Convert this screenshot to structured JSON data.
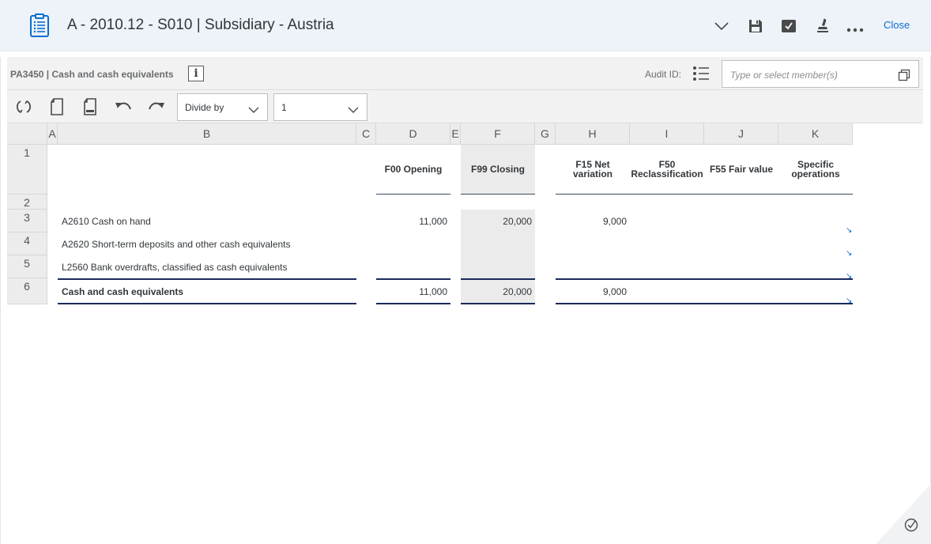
{
  "header": {
    "title": "A - 2010.12 - S010 | Subsidiary - Austria",
    "close_label": "Close",
    "icons": [
      "clipboard-list-icon",
      "chevron-down-icon",
      "save-icon",
      "checkbox-icon",
      "stamp-icon",
      "more-icon"
    ]
  },
  "infobar": {
    "form_title": "PA3450 | Cash and cash equivalents",
    "info_glyph": "i",
    "audit_label": "Audit ID:",
    "member_placeholder": "Type or select member(s)"
  },
  "toolbar": {
    "divide_label": "Divide by",
    "scale_value": "1"
  },
  "grid": {
    "column_letters": [
      "A",
      "B",
      "C",
      "D",
      "E",
      "F",
      "G",
      "H",
      "I",
      "J",
      "K"
    ],
    "row_numbers": [
      "1",
      "2",
      "3",
      "4",
      "5",
      "6"
    ],
    "column_headers": {
      "D": [
        "F00 Opening"
      ],
      "F": [
        "F99 Closing"
      ],
      "H": [
        "F15 Net",
        "variation"
      ],
      "I": [
        "F50",
        "Reclassification"
      ],
      "J": [
        "F55 Fair value"
      ],
      "K": [
        "Specific",
        "operations"
      ]
    },
    "rows": [
      {
        "label": "A2610 Cash on hand",
        "D": "11,000",
        "F": "20,000",
        "H": "9,000"
      },
      {
        "label": "A2620 Short-term deposits and other cash equivalents",
        "D": "",
        "F": "",
        "H": ""
      },
      {
        "label": "L2560 Bank overdrafts, classified as cash equivalents",
        "D": "",
        "F": "",
        "H": ""
      },
      {
        "label": "Cash and cash equivalents",
        "D": "11,000",
        "F": "20,000",
        "H": "9,000"
      }
    ]
  },
  "colors": {
    "accent": "#0a6ed1",
    "header_bg": "#edf3f8",
    "total_line": "#1c2a5c",
    "closing_shade": "#ebebeb"
  }
}
